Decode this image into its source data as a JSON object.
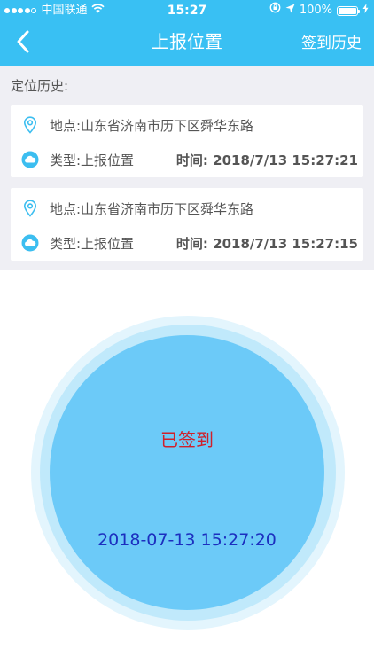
{
  "status_bar": {
    "carrier": "中国联通",
    "time": "15:27",
    "battery": "100%"
  },
  "navbar": {
    "title": "上报位置",
    "right_action": "签到历史"
  },
  "history": {
    "label": "定位历史:",
    "records": [
      {
        "location": "地点:山东省济南市历下区舜华东路",
        "type": "类型:上报位置",
        "time": "时间: 2018/7/13 15:27:21"
      },
      {
        "location": "地点:山东省济南市历下区舜华东路",
        "type": "类型:上报位置",
        "time": "时间: 2018/7/13 15:27:15"
      }
    ]
  },
  "checkin": {
    "status": "已签到",
    "datetime": "2018-07-13 15:27:20"
  },
  "colors": {
    "header": "#39c0f3",
    "circle": "#6ccaf8",
    "status_text": "#d0202a",
    "datetime_text": "#1c2fbf"
  },
  "icons": [
    "signal-dots-icon",
    "wifi-icon",
    "lock-rotation-icon",
    "location-arrow-icon",
    "battery-icon",
    "charging-icon",
    "back-chevron-icon",
    "location-pin-icon",
    "cloud-icon"
  ]
}
